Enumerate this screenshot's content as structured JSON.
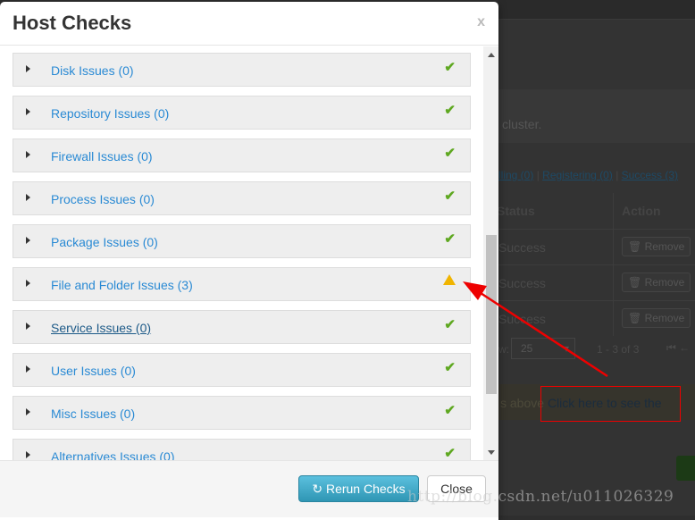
{
  "modal": {
    "title": "Host Checks",
    "close_x": "x",
    "items": [
      {
        "label": "Disk Issues (0)",
        "status": "ok"
      },
      {
        "label": "Repository Issues (0)",
        "status": "ok"
      },
      {
        "label": "Firewall Issues (0)",
        "status": "ok"
      },
      {
        "label": "Process Issues (0)",
        "status": "ok"
      },
      {
        "label": "Package Issues (0)",
        "status": "ok"
      },
      {
        "label": "File and Folder Issues (3)",
        "status": "warning"
      },
      {
        "label": "Service Issues (0)",
        "status": "ok"
      },
      {
        "label": "User Issues (0)",
        "status": "ok"
      },
      {
        "label": "Misc Issues (0)",
        "status": "ok"
      },
      {
        "label": "Alternatives Issues (0)",
        "status": "ok"
      }
    ],
    "rerun_label": "Rerun Checks",
    "close_label": "Close"
  },
  "background": {
    "cluster_text": "cluster.",
    "filters": [
      "lling (0)",
      "Registering (0)",
      "Success (3)"
    ],
    "columns": [
      "Status",
      "Action"
    ],
    "rows": [
      {
        "status": "Success",
        "action": "Remove"
      },
      {
        "status": "Success",
        "action": "Remove"
      },
      {
        "status": "Success",
        "action": "Remove"
      }
    ],
    "show_label": "w:",
    "page_size": "25",
    "range": "1 - 3 of 3",
    "note_prefix": "s above",
    "note_link": "Click here to see the"
  },
  "watermark": "http://blog.csdn.net/u011026329",
  "colors": {
    "ok": "#5fa821",
    "warning": "#f0b400",
    "annotation": "#e00000",
    "link": "#2a8ad4"
  }
}
